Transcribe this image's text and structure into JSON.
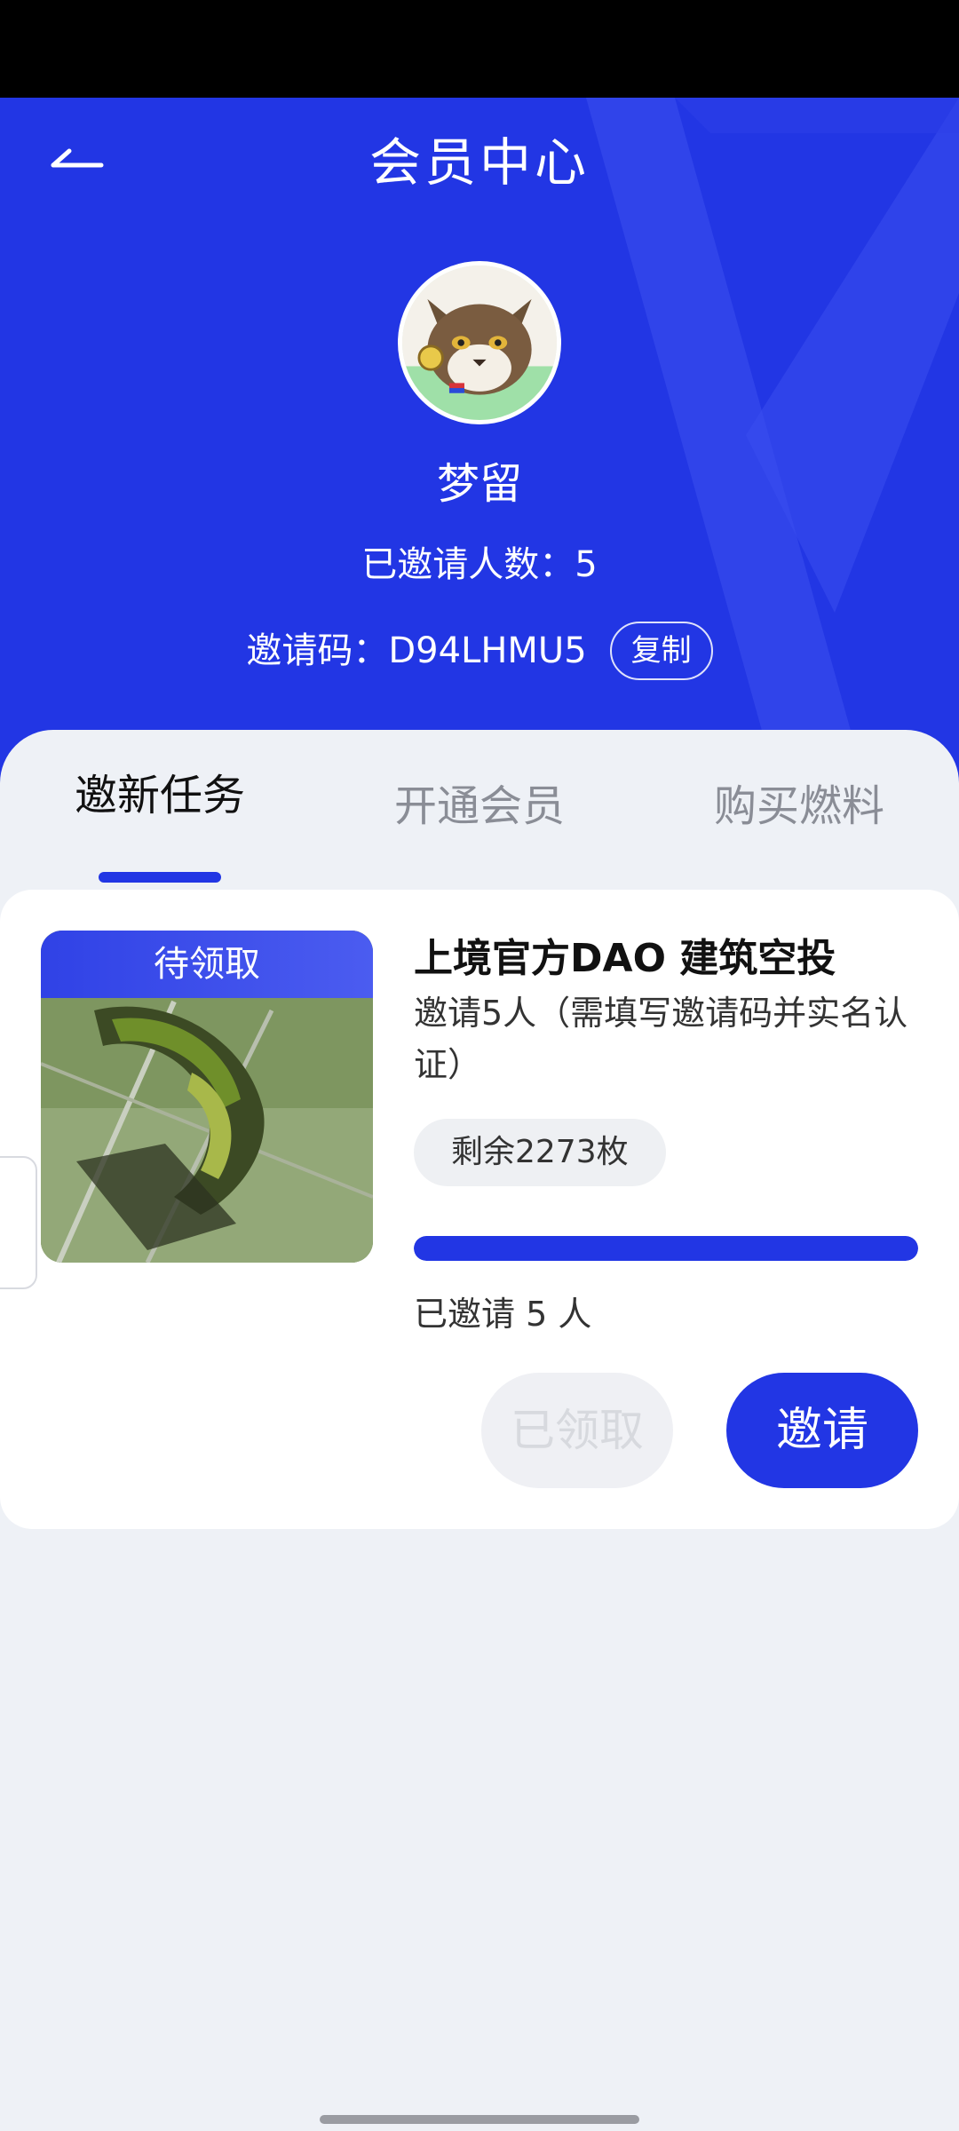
{
  "header": {
    "title": "会员中心",
    "back_icon": "back-arrow-icon"
  },
  "profile": {
    "username": "梦留",
    "invited_count_label": "已邀请人数：",
    "invited_count": "5",
    "invite_code_label": "邀请码：",
    "invite_code": "D94LHMU5",
    "copy_label": "复制"
  },
  "tabs": [
    {
      "label": "邀新任务",
      "active": true
    },
    {
      "label": "开通会员",
      "active": false
    },
    {
      "label": "购买燃料",
      "active": false
    }
  ],
  "task": {
    "badge": "待领取",
    "title": "上境官方DAO 建筑空投",
    "description": "邀请5人（需填写邀请码并实名认证）",
    "remaining": "剩余2273枚",
    "progress": 1.0,
    "invited_status": "已邀请 5 人",
    "claimed_button": "已领取",
    "invite_button": "邀请"
  },
  "colors": {
    "accent": "#2236e4",
    "background": "#eef1f6"
  }
}
